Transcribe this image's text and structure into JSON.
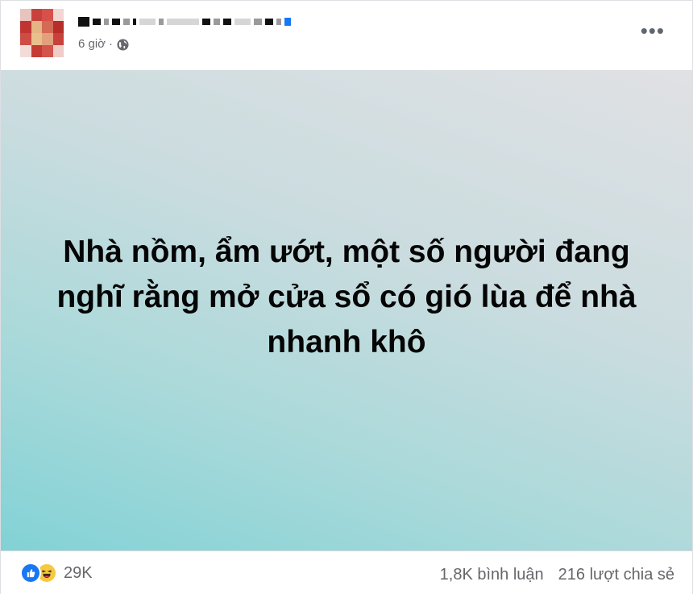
{
  "post": {
    "time": "6 giờ",
    "separator": "·",
    "privacy_icon": "globe-icon",
    "menu_icon": "more-options-icon",
    "text": "Nhà nồm, ẩm ướt, một số người đang nghĩ rằng mở cửa sổ có gió lùa để nhà nhanh khô",
    "background": {
      "from": "#82d2d6",
      "to": "#e0e1e4"
    }
  },
  "footer": {
    "reactions": [
      "like-icon",
      "haha-icon"
    ],
    "reaction_count": "29K",
    "comments": "1,8K bình luận",
    "shares": "216 lượt chia sẻ"
  }
}
